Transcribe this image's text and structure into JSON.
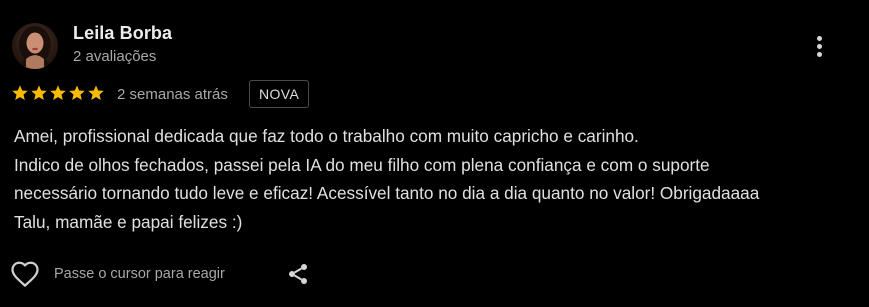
{
  "reviewer": {
    "name": "Leila Borba",
    "reviews_count": "2 avaliações"
  },
  "rating": {
    "stars": 5,
    "max": 5,
    "color": "#f6bb06"
  },
  "date": "2 semanas atrás",
  "badge": "NOVA",
  "review_lines": [
    "Amei, profissional dedicada que faz todo o trabalho com muito capricho e carinho.",
    "Indico de olhos fechados, passei pela IA do meu filho com plena confiança e com o suporte",
    "necessário tornando tudo leve e eficaz! Acessível tanto no dia a dia quanto no valor! Obrigadaaaa",
    "Talu, mamãe e papai felizes :)"
  ],
  "actions": {
    "like_label": "Passe o cursor para reagir",
    "like_icon": "heart-outline-icon",
    "share_icon": "share-icon",
    "more_icon": "more-vert-icon"
  }
}
